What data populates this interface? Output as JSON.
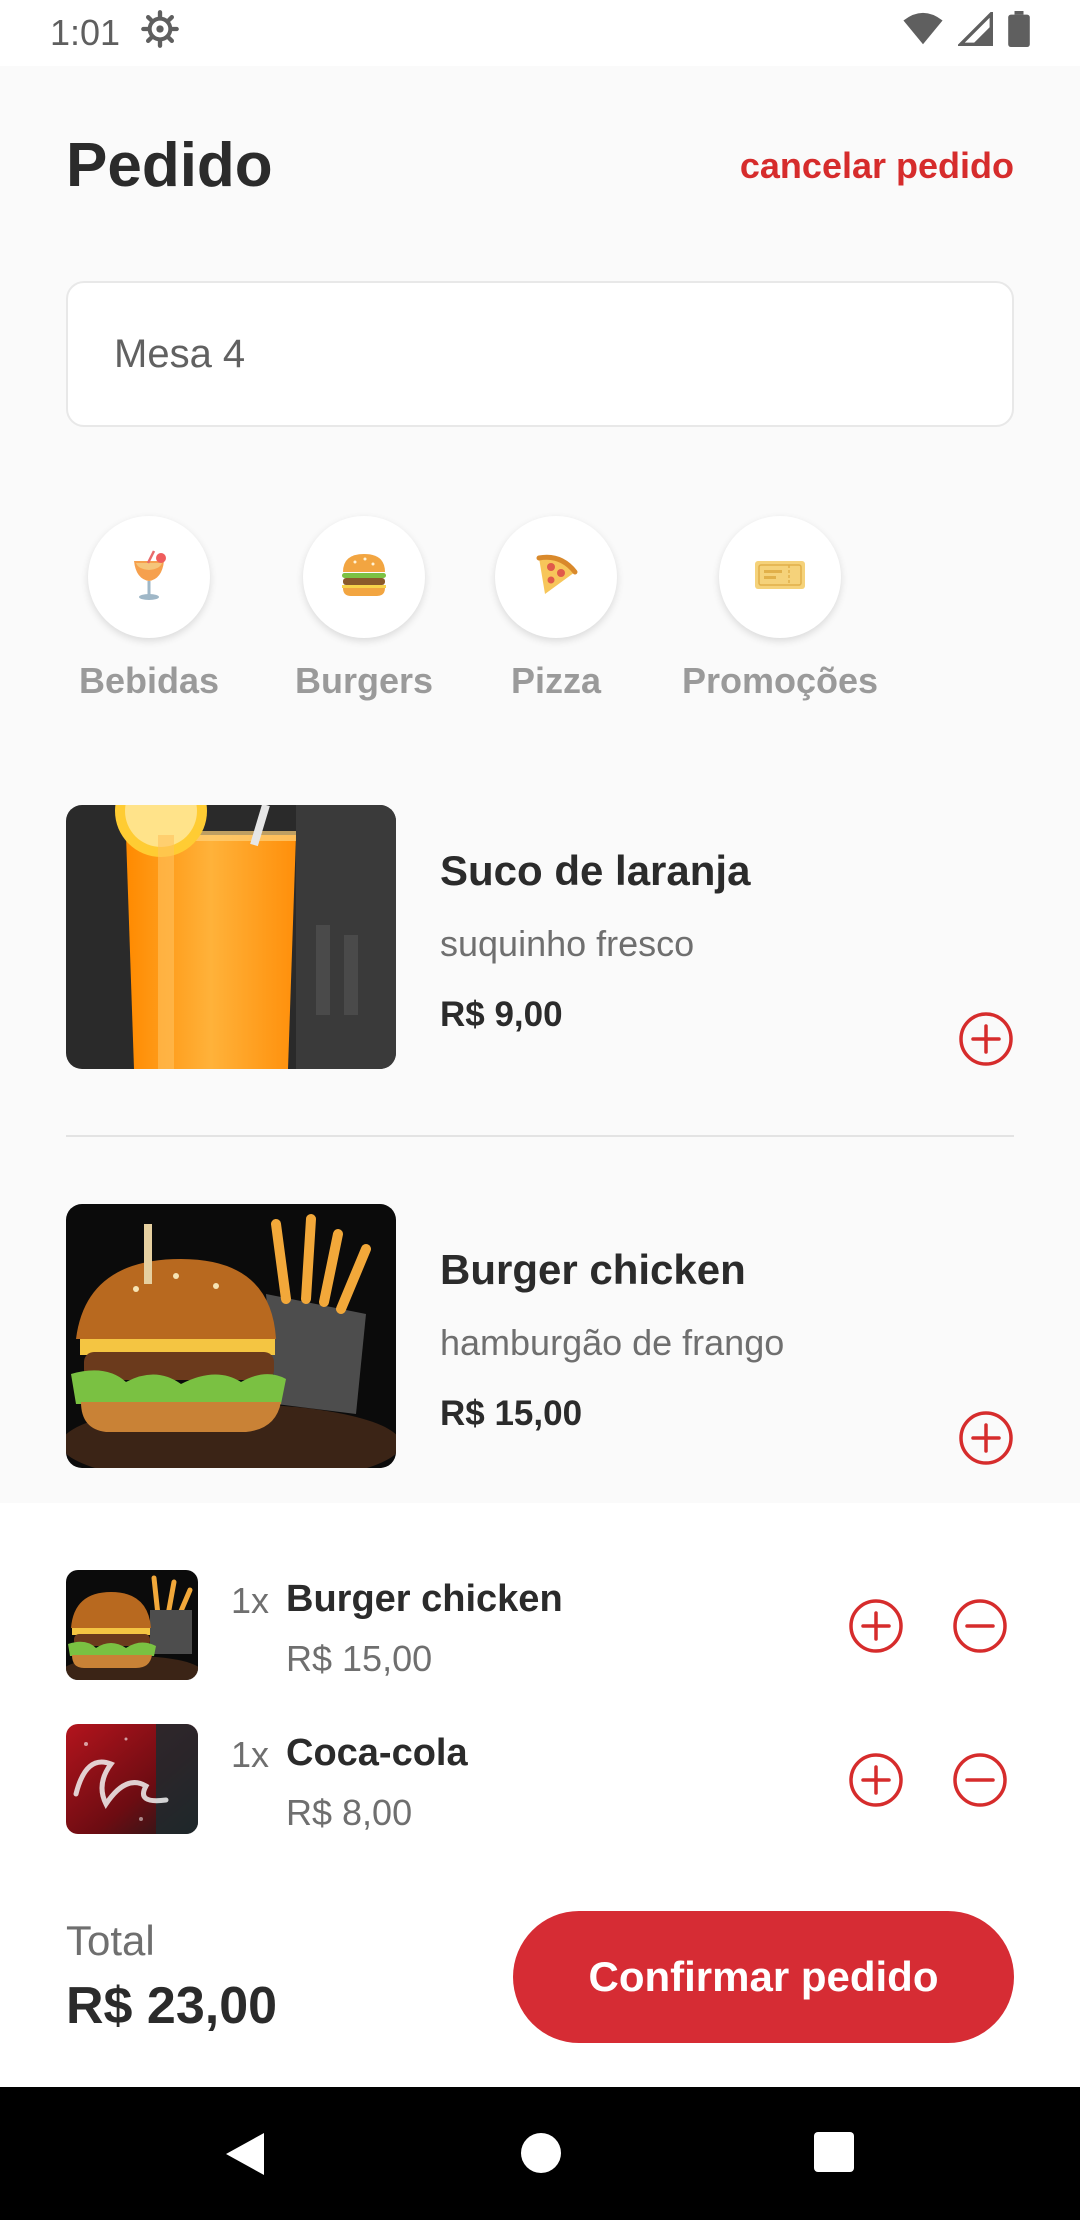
{
  "status_bar": {
    "time": "1:01"
  },
  "header": {
    "title": "Pedido",
    "cancel_label": "cancelar pedido"
  },
  "table_input": {
    "value": "Mesa 4",
    "placeholder": ""
  },
  "categories": [
    {
      "label": "Bebidas",
      "icon": "cocktail-icon"
    },
    {
      "label": "Burgers",
      "icon": "burger-icon"
    },
    {
      "label": "Pizza",
      "icon": "pizza-slice-icon"
    },
    {
      "label": "Promoções",
      "icon": "ticket-icon"
    }
  ],
  "products": [
    {
      "name": "Suco de laranja",
      "description": "suquinho fresco",
      "price": "R$ 9,00"
    },
    {
      "name": "Burger chicken",
      "description": "hamburgão de frango",
      "price": "R$ 15,00"
    }
  ],
  "cart": {
    "items": [
      {
        "qty": "1x",
        "name": "Burger chicken",
        "price": "R$ 15,00"
      },
      {
        "qty": "1x",
        "name": "Coca-cola",
        "price": "R$ 8,00"
      }
    ]
  },
  "footer": {
    "total_label": "Total",
    "total_value": "R$ 23,00",
    "confirm_label": "Confirmar pedido"
  },
  "colors": {
    "accent": "#d62c34",
    "background": "#fafafa",
    "text": "#2b2b2b",
    "muted": "#9a9a9a"
  }
}
